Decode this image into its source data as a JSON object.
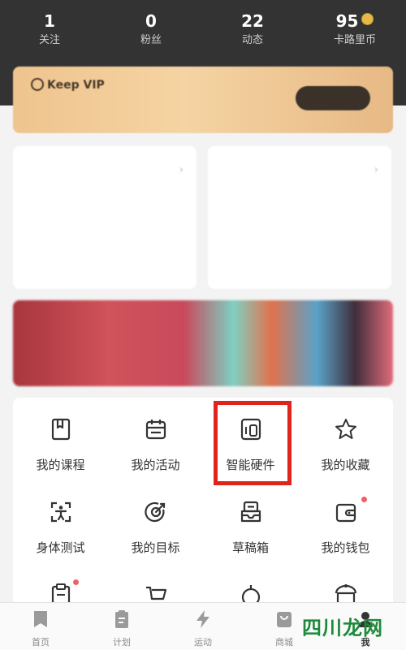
{
  "header": {
    "stats": [
      {
        "value": "1",
        "label": "关注"
      },
      {
        "value": "0",
        "label": "粉丝"
      },
      {
        "value": "22",
        "label": "动态"
      },
      {
        "value": "95",
        "label": "卡路里币"
      }
    ]
  },
  "membership": {
    "title": "Keep VIP",
    "description": "",
    "button": ""
  },
  "cards": [
    {
      "title": "",
      "subtitle": "",
      "value": "",
      "unit": "",
      "footer": ""
    },
    {
      "title": "",
      "subtitle": "",
      "value": "",
      "unit": "",
      "footer": ""
    }
  ],
  "promo": {
    "text": ""
  },
  "grid": {
    "items": [
      {
        "label": "我的课程",
        "icon": "course-book-icon",
        "badge": false
      },
      {
        "label": "我的活动",
        "icon": "calendar-activity-icon",
        "badge": false
      },
      {
        "label": "智能硬件",
        "icon": "smart-hardware-icon",
        "badge": false,
        "highlighted": true
      },
      {
        "label": "我的收藏",
        "icon": "star-icon",
        "badge": false
      },
      {
        "label": "身体测试",
        "icon": "body-test-icon",
        "badge": false
      },
      {
        "label": "我的目标",
        "icon": "target-icon",
        "badge": false
      },
      {
        "label": "草稿箱",
        "icon": "drafts-inbox-icon",
        "badge": false
      },
      {
        "label": "我的钱包",
        "icon": "wallet-icon",
        "badge": true
      }
    ],
    "partial_row_icons": [
      "clipboard-icon",
      "cart-icon",
      "timer-icon",
      "gift-icon"
    ]
  },
  "tabbar": {
    "items": [
      {
        "label": "首页",
        "icon": "home-bookmark-icon"
      },
      {
        "label": "计划",
        "icon": "plan-clipboard-icon"
      },
      {
        "label": "运动",
        "icon": "lightning-icon"
      },
      {
        "label": "商城",
        "icon": "shop-bag-icon"
      },
      {
        "label": "我",
        "icon": "profile-icon",
        "active": true
      }
    ]
  },
  "watermark": {
    "text": "四川龙网"
  },
  "colors": {
    "header_bg": "#333333",
    "accent_red": "#e0241b",
    "badge_red": "#f05f63",
    "vip_gold": "#efc48e"
  }
}
